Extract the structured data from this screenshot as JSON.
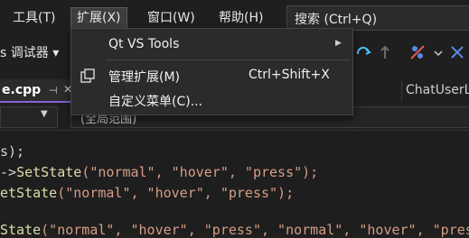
{
  "menubar": {
    "items": [
      {
        "label": "工具(T)"
      },
      {
        "label": "扩展(X)"
      },
      {
        "label": "窗口(W)"
      },
      {
        "label": "帮助(H)"
      }
    ],
    "search_label": "搜索 (Ctrl+Q)"
  },
  "toolbar": {
    "debugger_label": "s 调试器 ▾"
  },
  "tabs": {
    "active_file": "e.cpp",
    "pin_glyph": "⊣",
    "close_glyph": "✕",
    "right_tab": "ChatUserL"
  },
  "navbar": {
    "scope_text": "(全局范围)"
  },
  "code": {
    "lines": [
      {
        "a": "s);",
        "b": "",
        "c": ""
      },
      {
        "a": "->",
        "b": "SetState",
        "c": "(\"normal\", \"hover\", \"press\");"
      },
      {
        "a": "e",
        "b": "tState",
        "c": "(\"normal\", \"hover\", \"press\");"
      },
      {
        "a": "",
        "b": "",
        "c": ""
      },
      {
        "a": "",
        "b": "State",
        "c": "(\"normal\", \"hover\", \"press\", \"normal\", \"hover\", \"pres"
      }
    ]
  },
  "dropdown": {
    "items": [
      {
        "label": "Qt VS Tools",
        "shortcut": "",
        "has_submenu": true
      },
      {
        "label": "管理扩展(M)",
        "shortcut": "Ctrl+Shift+X",
        "has_submenu": false
      },
      {
        "label": "自定义菜单(C)...",
        "shortcut": "",
        "has_submenu": false
      }
    ],
    "submenu_arrow": "▶"
  }
}
